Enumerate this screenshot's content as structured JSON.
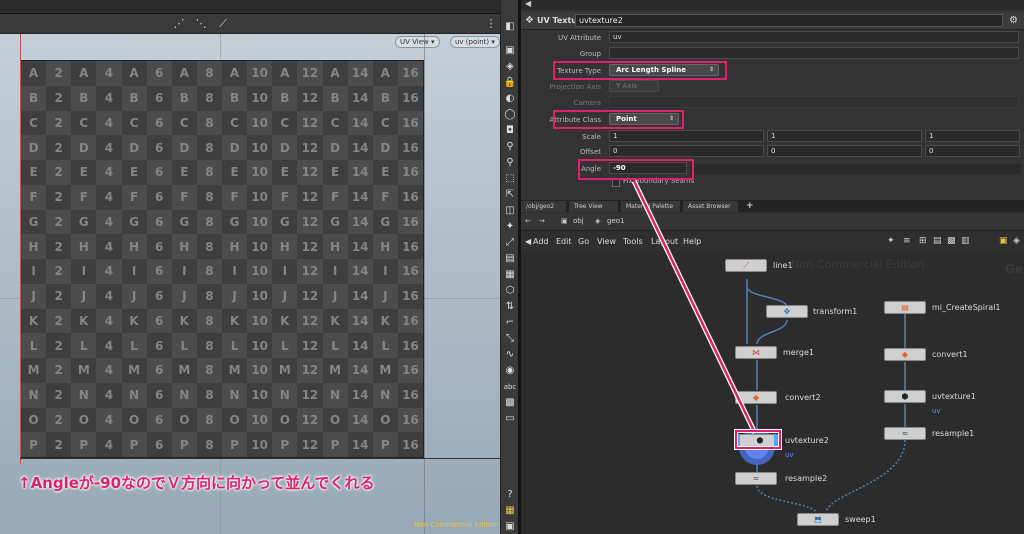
{
  "viewport": {
    "uv_view_menu": "UV View ▾",
    "uv_attr_menu": "uv (point) ▾",
    "grid_numbers_odd_rows": [
      "A",
      "B",
      "C",
      "D",
      "E",
      "F",
      "G",
      "H",
      "I",
      "J",
      "K",
      "L",
      "M",
      "N",
      "O",
      "P"
    ],
    "caption": "↑Angleが-90なのでＶ方向に向かって並んでくれる",
    "non_commercial": "Non-Commercial Edition"
  },
  "params": {
    "node_type": "UV Texture",
    "node_name": "uvtexture2",
    "uv_attribute_label": "UV Attribute",
    "uv_attribute_value": "uv",
    "group_label": "Group",
    "texture_type_label": "Texture Type",
    "texture_type_value": "Arc Length Spline",
    "projection_axis_label": "Projection Axis",
    "projection_axis_value": "Y Axis",
    "camera_label": "Camera",
    "attribute_class_label": "Attribute Class",
    "attribute_class_value": "Point",
    "scale_label": "Scale",
    "scale_values": [
      "1",
      "1",
      "1"
    ],
    "offset_label": "Offset",
    "offset_values": [
      "0",
      "0",
      "0"
    ],
    "angle_label": "Angle",
    "angle_value": "-90",
    "fix_seams_label": "Fix Boundary Seams"
  },
  "network": {
    "tabs": [
      "/obj/geo2",
      "Tree View",
      "Material Palette",
      "Asset Browser"
    ],
    "tab_plus": "+",
    "path_obj": "obj",
    "path_geo": "geo1",
    "menu": [
      "Add",
      "Edit",
      "Go",
      "View",
      "Tools",
      "Layout",
      "Help"
    ],
    "watermark": "Non-Commercial Edition",
    "watermark_right": "Geo",
    "nodes": {
      "line1": "line1",
      "transform1": "transform1",
      "merge1": "merge1",
      "convert2": "convert2",
      "uvtexture2": "uvtexture2",
      "uvtexture2_sub": "uv",
      "resample2": "resample2",
      "sweep1": "sweep1",
      "mi_CreateSpiral1": "mi_CreateSpiral1",
      "convert1": "convert1",
      "uvtexture1": "uvtexture1",
      "uvtexture1_sub": "uv",
      "resample1": "resample1"
    }
  },
  "colors": {
    "highlight": "#e0206a",
    "accent_blue": "#4aa8ff"
  }
}
